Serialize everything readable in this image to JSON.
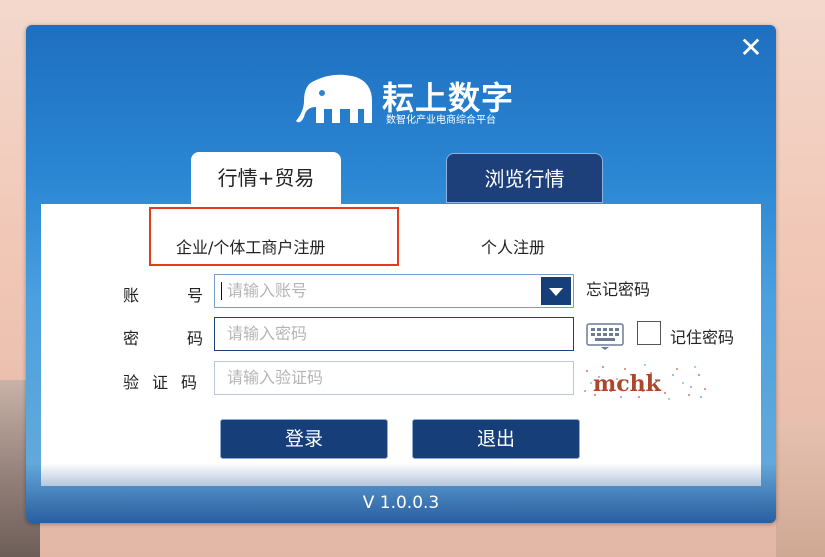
{
  "brand": {
    "title": "耘上数字",
    "subtitle": "数智化产业电商综合平台"
  },
  "window": {
    "close_label": "✕",
    "version": "V 1.0.0.3"
  },
  "tabs": [
    {
      "label": "行情+贸易",
      "active": true
    },
    {
      "label": "浏览行情",
      "active": false
    }
  ],
  "register": {
    "business_label": "企业/个体工商户注册",
    "personal_label": "个人注册"
  },
  "form": {
    "account_label": [
      "账",
      "号"
    ],
    "password_label": [
      "密",
      "码"
    ],
    "captcha_label": [
      "验",
      "证",
      "码"
    ],
    "account_placeholder": "请输入账号",
    "password_placeholder": "请输入密码",
    "captcha_placeholder": "请输入验证码",
    "forgot_label": "忘记密码",
    "remember_label": "记住密码",
    "remember_checked": false,
    "captcha_text": "mchk"
  },
  "buttons": {
    "login_label": "登录",
    "exit_label": "退出"
  },
  "colors": {
    "primary": "#163e78",
    "highlight_border": "#e23b1d",
    "header_blue": "#2a86d3"
  }
}
